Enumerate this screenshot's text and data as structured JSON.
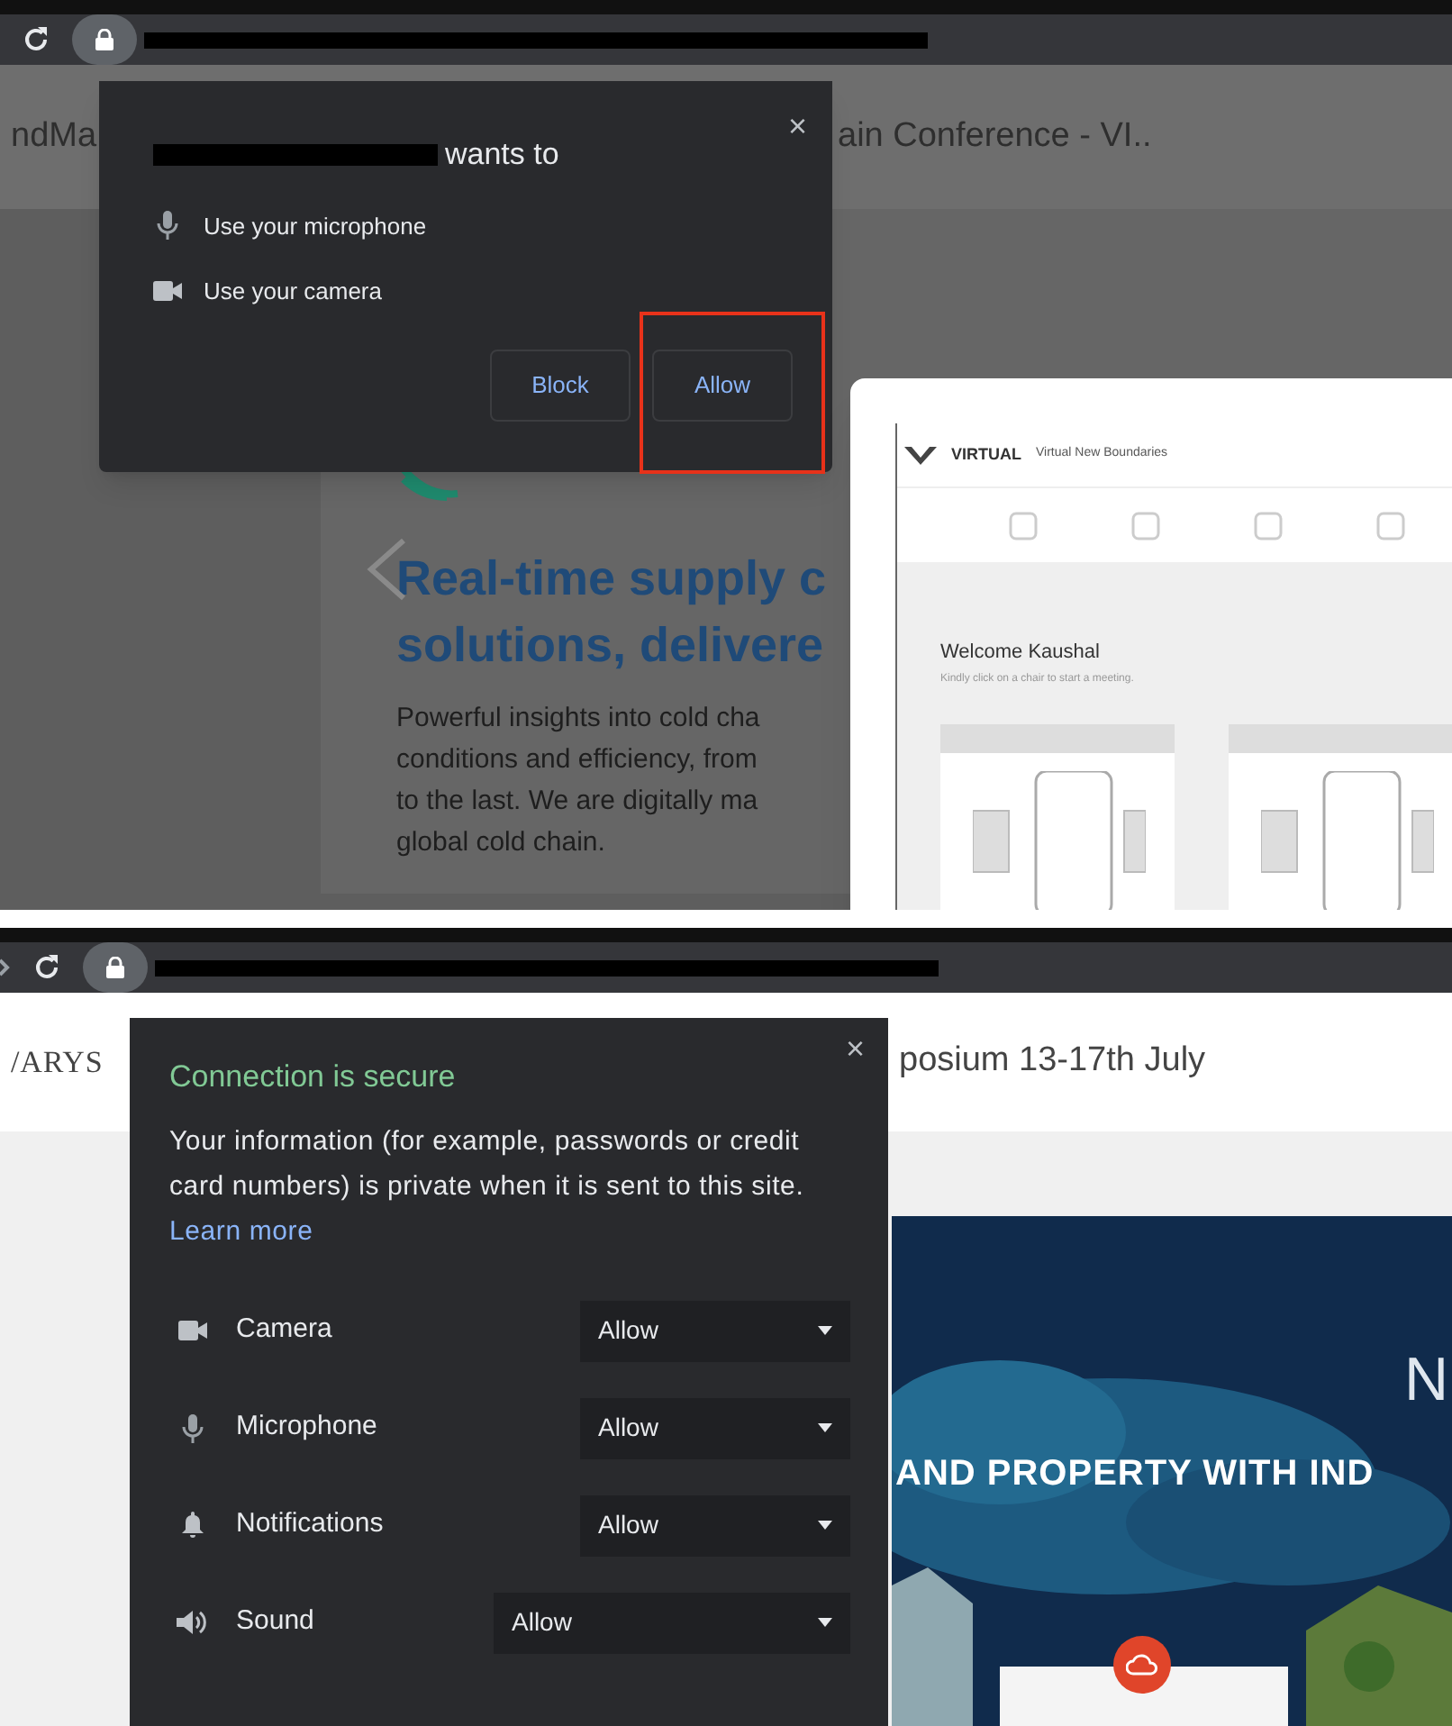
{
  "top_screen": {
    "page": {
      "tab_title_left": "ndMa",
      "tab_title_right": "ain Conference - VI..",
      "heading_lines": [
        "Real-time supply c",
        "solutions, delivere"
      ],
      "paragraph_lines": [
        "Powerful insights into cold cha",
        "conditions and efficiency, from",
        "to the last. We are digitally ma",
        "global cold chain."
      ]
    },
    "permission_prompt": {
      "title": "wants to",
      "close_button": "×",
      "items": [
        {
          "kind": "microphone",
          "label": "Use your microphone"
        },
        {
          "kind": "camera",
          "label": "Use your camera"
        }
      ],
      "buttons": [
        {
          "label": "Block",
          "highlighted": false
        },
        {
          "label": "Allow",
          "highlighted": true
        }
      ]
    },
    "preview_window": {
      "brand": "VIRTUAL",
      "brand_subtitle": "Virtual New Boundaries",
      "welcome": "Welcome Kaushal",
      "hint": "Kindly click on a chair to start a meeting."
    }
  },
  "bottom_screen": {
    "page": {
      "logo": "/ARYS",
      "title": "posium 13-17th July",
      "hero_heading": "AND PROPERTY WITH IND",
      "hero_letter": "N"
    },
    "site_info": {
      "title": "Connection is secure",
      "close_button": "×",
      "description": "Your information (for example, passwords or credit card numbers) is private when it is sent to this site.",
      "link": "Learn more",
      "permissions": [
        {
          "kind": "camera",
          "label": "Camera",
          "value": "Allow"
        },
        {
          "kind": "microphone",
          "label": "Microphone",
          "value": "Allow"
        },
        {
          "kind": "notifications",
          "label": "Notifications",
          "value": "Allow"
        },
        {
          "kind": "sound",
          "label": "Sound",
          "value": "Allow"
        }
      ]
    }
  }
}
